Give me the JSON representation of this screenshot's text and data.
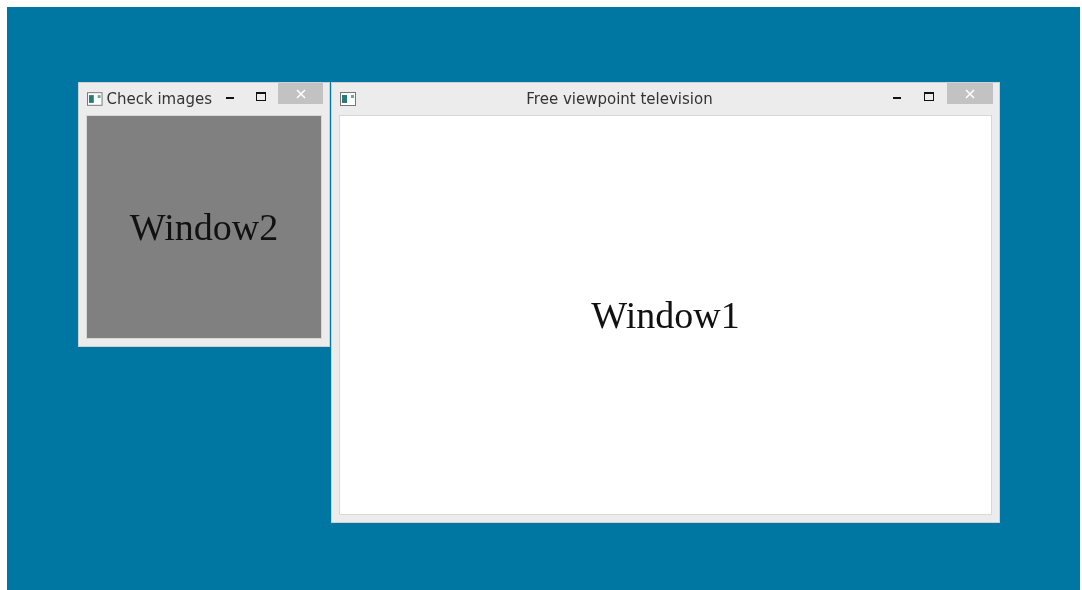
{
  "windows": [
    {
      "title": "Check images",
      "content_text": "Window2",
      "color": "#808080"
    },
    {
      "title": "Free viewpoint television",
      "content_text": "Window1",
      "color": "#ffffff"
    }
  ]
}
